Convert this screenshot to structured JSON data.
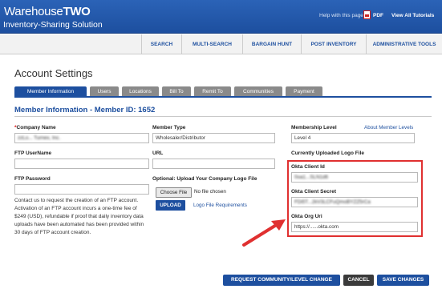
{
  "header": {
    "logo_warehouse": "Warehouse",
    "logo_two": "TWO",
    "subtitle": "Inventory-Sharing Solution",
    "help_text": "Help with this page:",
    "pdf_label": "PDF",
    "tutorials_label": "View All Tutorials"
  },
  "nav": {
    "items": [
      "SEARCH",
      "MULTI-SEARCH",
      "BARGAIN HUNT",
      "POST INVENTORY",
      "ADMINISTRATIVE TOOLS"
    ]
  },
  "page": {
    "title": "Account Settings",
    "tabs": [
      "Member Information",
      "Users",
      "Locations",
      "Bill To",
      "Remit To",
      "Communities",
      "Payment"
    ],
    "active_tab": "Member Information",
    "section_title": "Member Information - Member ID: 1652"
  },
  "form": {
    "company_name": {
      "label": "Company Name",
      "required_mark": "*",
      "value": "zzLo... Turnex, Inc."
    },
    "ftp_username": {
      "label": "FTP UserName",
      "value": ""
    },
    "ftp_password": {
      "label": "FTP Password",
      "value": ""
    },
    "ftp_info": "Contact us to request the creation of an FTP account. Activation of an FTP account incurs a one-time fee of $249 (USD), refundable if proof that daily inventory data uploads have been automated has been provided within 30 days of FTP account creation.",
    "member_type": {
      "label": "Member Type",
      "value": "Wholesaler/Distributor"
    },
    "url": {
      "label": "URL",
      "value": ""
    },
    "logo_upload": {
      "label": "Optional: Upload Your Company Logo File",
      "choose_button": "Choose File",
      "no_file": "No file chosen",
      "upload_button": "UPLOAD",
      "requirements_link": "Logo File Requirements"
    },
    "membership_level": {
      "label": "Membership Level",
      "value": "Level 4",
      "about_link": "About Member Levels"
    },
    "uploaded_logo_label": "Currently Uploaded Logo File",
    "okta_client_id": {
      "label": "Okta Client Id",
      "value": "0oa1...SLN1d6"
    },
    "okta_client_secret": {
      "label": "Okta Client Secret",
      "value": "FDi5T...2kV3LCFuQmoBYZZ5rCa"
    },
    "okta_org_uri": {
      "label": "Okta Org Uri",
      "value": "https://......okta.com"
    }
  },
  "footer": {
    "request_button": "REQUEST COMMUNITY/LEVEL CHANGE",
    "cancel_button": "CANCEL",
    "save_button": "SAVE CHANGES"
  },
  "colors": {
    "brand_blue": "#1d4f9f",
    "tab_gray": "#8a8a8a",
    "highlight_red": "#e03030"
  }
}
